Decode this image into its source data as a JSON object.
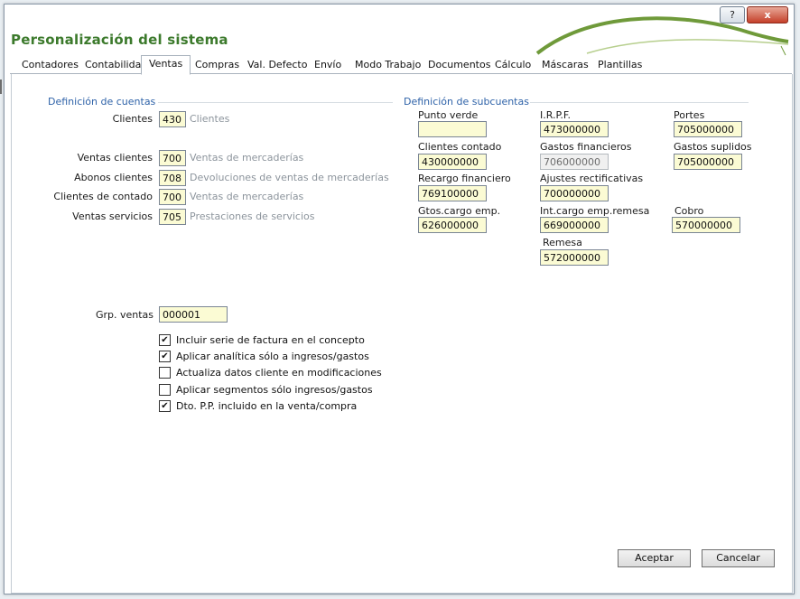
{
  "window": {
    "title": "Personalización del sistema",
    "help_label": "?",
    "close_label": "x"
  },
  "tabs": [
    {
      "label": "Contadores"
    },
    {
      "label": "Contabilidad"
    },
    {
      "label": "Ventas",
      "active": true
    },
    {
      "label": "Compras"
    },
    {
      "label": "Val. Defecto"
    },
    {
      "label": "Envío"
    },
    {
      "label": "Modo Trabajo"
    },
    {
      "label": "Documentos"
    },
    {
      "label": "Cálculo"
    },
    {
      "label": "Máscaras"
    },
    {
      "label": "Plantillas"
    }
  ],
  "accounts": {
    "title": "Definición de cuentas",
    "rows": [
      {
        "label": "Clientes",
        "code": "430",
        "desc": "Clientes"
      },
      {
        "label": "Ventas clientes",
        "code": "700",
        "desc": "Ventas de mercaderías"
      },
      {
        "label": "Abonos clientes",
        "code": "708",
        "desc": "Devoluciones de ventas de mercaderías"
      },
      {
        "label": "Clientes de contado",
        "code": "700",
        "desc": "Ventas de mercaderías"
      },
      {
        "label": "Ventas servicios",
        "code": "705",
        "desc": "Prestaciones de servicios"
      }
    ]
  },
  "subaccounts": {
    "title": "Definición de subcuentas",
    "fields": [
      {
        "label": "Punto verde",
        "value": ""
      },
      {
        "label": "I.R.P.F.",
        "value": "473000000"
      },
      {
        "label": "Portes",
        "value": "705000000"
      },
      {
        "label": "Clientes contado",
        "value": "430000000"
      },
      {
        "label": "Gastos financieros",
        "value": "706000000",
        "disabled": true
      },
      {
        "label": "Gastos suplidos",
        "value": "705000000"
      },
      {
        "label": "Recargo financiero",
        "value": "769100000"
      },
      {
        "label": "Ajustes rectificativas",
        "value": "700000000"
      },
      {
        "label": "Gtos.cargo emp.",
        "value": "626000000"
      },
      {
        "label": "Int.cargo emp.remesa",
        "value": "669000000"
      },
      {
        "label": "Cobro",
        "value": "570000000"
      },
      {
        "label": "Remesa",
        "value": "572000000"
      }
    ]
  },
  "grp_ventas": {
    "label": "Grp. ventas",
    "value": "000001"
  },
  "options": [
    {
      "label": "Incluir serie de factura en el concepto",
      "checked": true
    },
    {
      "label": "Aplicar analítica sólo a ingresos/gastos",
      "checked": true
    },
    {
      "label": "Actualiza datos cliente en modificaciones",
      "checked": false
    },
    {
      "label": "Aplicar segmentos sólo ingresos/gastos",
      "checked": false
    },
    {
      "label": "Dto. P.P. incluido en la venta/compra",
      "checked": true
    }
  ],
  "buttons": {
    "accept": "Aceptar",
    "cancel": "Cancelar"
  },
  "colors": {
    "title": "#3c7a2c",
    "group_title": "#2e62a8",
    "field_bg": "#fbfbd4",
    "close_red": "#c5402a"
  }
}
